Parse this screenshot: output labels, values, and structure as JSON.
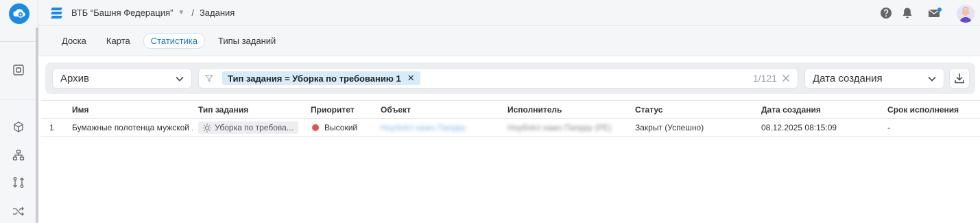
{
  "header": {
    "project": "ВТБ “Башня Федерация”",
    "page": "Задания"
  },
  "tabs": [
    {
      "label": "Доска",
      "active": false
    },
    {
      "label": "Карта",
      "active": false
    },
    {
      "label": "Статистика",
      "active": true
    },
    {
      "label": "Типы заданий",
      "active": false
    }
  ],
  "toolbar": {
    "archive_select": "Архив",
    "filter_chip": "Тип задания = Уборка по требованию 1",
    "filter_count": "1/121",
    "sort_select": "Дата создания"
  },
  "table": {
    "columns": [
      "Имя",
      "Тип задания",
      "Приоритет",
      "Объект",
      "Исполнитель",
      "Статус",
      "Дата создания",
      "Срок исполнения"
    ],
    "rows": [
      {
        "num": "1",
        "name": "Бумажные полотенца мужской ...",
        "type": "Уборка по требова...",
        "priority": "Высокий",
        "object": "Ноублёл нажо Папрру",
        "executor": "Ноублёл нажо Папрру (РЕ)",
        "status": "Закрыт (Успешно)",
        "created": "08.12.2025 08:15:09",
        "deadline": "-"
      }
    ]
  },
  "colors": {
    "accent": "#1a73c7",
    "chip_bg": "#d6ecfb",
    "priority_high": "#e8504a",
    "logo_blue": "#1a8ae6"
  },
  "icons": {
    "rail": [
      "app-logo-icon",
      "dashboard-icon",
      "cube-icon",
      "hierarchy-icon",
      "git-compare-icon",
      "shuffle-icon"
    ],
    "header": [
      "help-icon",
      "bell-icon",
      "mail-icon",
      "avatar"
    ]
  }
}
